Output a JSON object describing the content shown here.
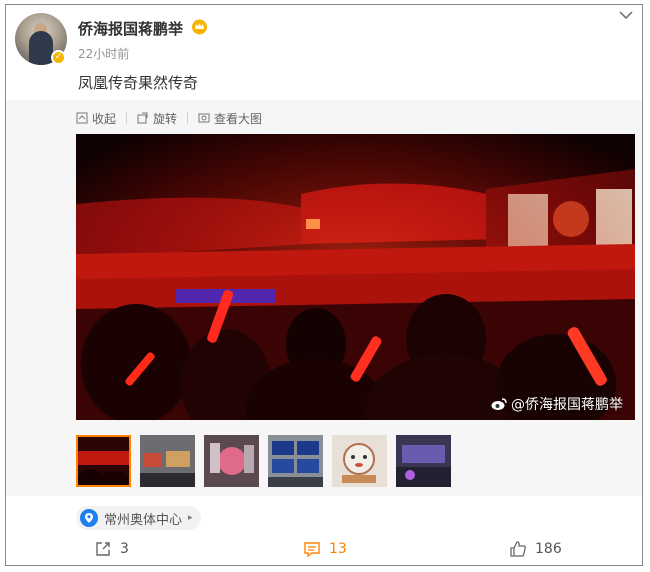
{
  "post": {
    "author": "侨海报国蒋鹏举",
    "time": "22小时前",
    "text": "凤凰传奇果然传奇"
  },
  "toolbar": {
    "collect": "收起",
    "rotate": "旋转",
    "view_large": "查看大图"
  },
  "image": {
    "watermark": "@侨海报国蒋鹏举",
    "thumbnail_count": 6,
    "active_thumbnail": 1
  },
  "location": "常州奥体中心",
  "actions": {
    "share_count": "3",
    "comment_count": "13",
    "like_count": "186"
  },
  "colors": {
    "accent": "#ff8200",
    "location_pin": "#1e7ff0",
    "badge": "#f7b500"
  },
  "icons": [
    "chevron-down-icon",
    "collect-icon",
    "rotate-icon",
    "view-large-icon",
    "location-pin-icon",
    "share-icon",
    "comment-icon",
    "like-icon",
    "weibo-logo-icon",
    "crown-icon",
    "verified-badge-icon"
  ]
}
